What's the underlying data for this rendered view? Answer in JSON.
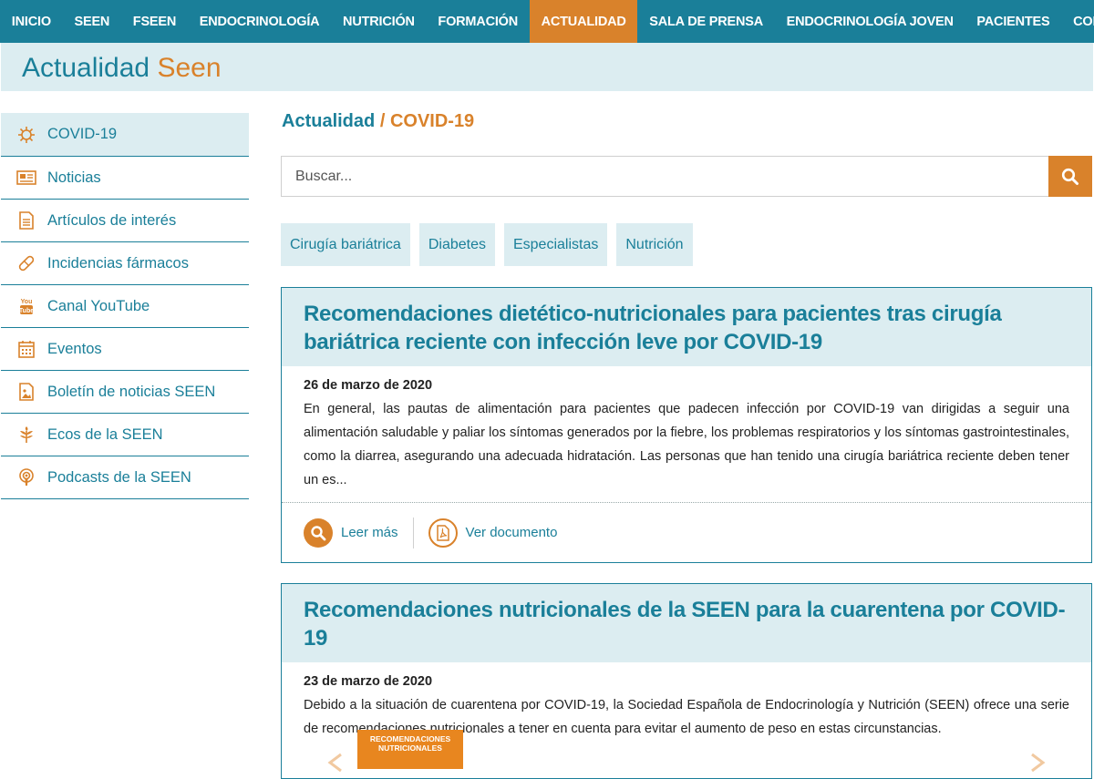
{
  "nav": {
    "items": [
      {
        "label": "INICIO"
      },
      {
        "label": "SEEN"
      },
      {
        "label": "FSEEN"
      },
      {
        "label": "ENDOCRINOLOGÍA"
      },
      {
        "label": "NUTRICIÓN"
      },
      {
        "label": "FORMACIÓN"
      },
      {
        "label": "ACTUALIDAD",
        "active": true
      },
      {
        "label": "SALA DE PRENSA"
      },
      {
        "label": "ENDOCRINOLOGÍA JOVEN"
      },
      {
        "label": "PACIENTES"
      },
      {
        "label": "CONTACTO"
      }
    ]
  },
  "banner": {
    "title_part1": "Actualidad",
    "title_part2": "Seen"
  },
  "sidebar": {
    "items": [
      {
        "label": "COVID-19",
        "icon": "virus-icon",
        "active": true
      },
      {
        "label": "Noticias",
        "icon": "newspaper-icon"
      },
      {
        "label": "Artículos de interés",
        "icon": "document-icon"
      },
      {
        "label": "Incidencias fármacos",
        "icon": "pill-icon"
      },
      {
        "label": "Canal YouTube",
        "icon": "youtube-icon"
      },
      {
        "label": "Eventos",
        "icon": "calendar-icon"
      },
      {
        "label": "Boletín de noticias SEEN",
        "icon": "image-file-icon"
      },
      {
        "label": "Ecos de la SEEN",
        "icon": "leaf-icon"
      },
      {
        "label": "Podcasts de la SEEN",
        "icon": "podcast-icon"
      }
    ]
  },
  "breadcrumb": {
    "section": "Actualidad",
    "separator": "/",
    "current": "COVID-19"
  },
  "search": {
    "placeholder": "Buscar..."
  },
  "tags": [
    "Cirugía bariátrica",
    "Diabetes",
    "Especialistas",
    "Nutrición"
  ],
  "articles": [
    {
      "title": "Recomendaciones dietético-nutricionales para pacientes tras cirugía bariátrica reciente con infección leve por COVID-19",
      "date": "26 de marzo de 2020",
      "excerpt": "En general, las pautas de alimentación para pacientes que padecen infección por COVID-19 van dirigidas a seguir una alimentación saludable y paliar los síntomas generados por la fiebre, los problemas respiratorios y los síntomas gastrointestinales, como la diarrea, asegurando una adecuada hidratación. Las personas que han tenido una cirugía bariátrica reciente deben tener un es...",
      "read_more": "Leer más",
      "view_doc": "Ver documento"
    },
    {
      "title": "Recomendaciones nutricionales de la SEEN para la cuarentena por COVID-19",
      "date": "23 de marzo de 2020",
      "excerpt": "Debido a la situación de cuarentena por COVID-19, la Sociedad Española de Endocrinología y Nutrición (SEEN) ofrece una serie de recomendaciones nutricionales a tener en cuenta para evitar el aumento de peso en estas circunstancias.",
      "thumb_title": "RECOMENDACIONES NUTRICIONALES"
    }
  ],
  "colors": {
    "primary": "#1a7f99",
    "accent": "#d9822b",
    "light": "#dcedf1"
  }
}
